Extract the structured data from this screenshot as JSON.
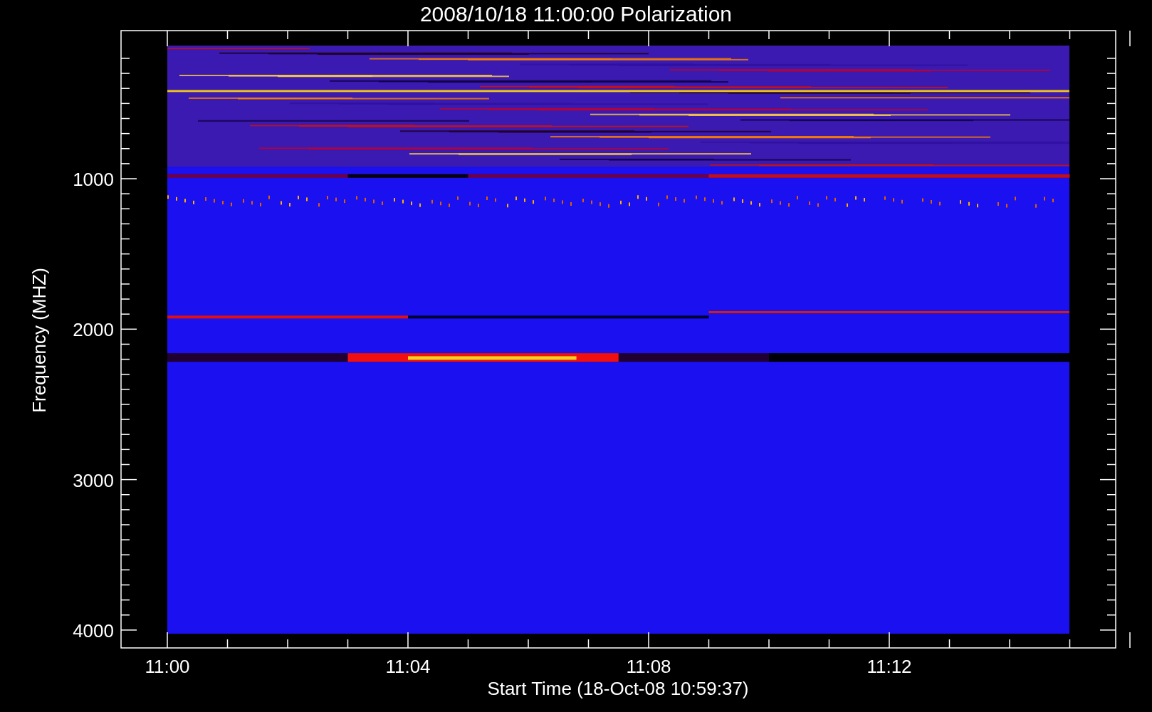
{
  "title": "2008/10/18 11:00:00 Polarization",
  "y_axis": {
    "label": "Frequency (MHZ)",
    "tick_labels": [
      "1000",
      "2000",
      "3000",
      "4000"
    ]
  },
  "x_axis": {
    "label": "Start Time (18-Oct-08 10:59:37)",
    "tick_labels": [
      "11:00",
      "11:04",
      "11:08",
      "11:12"
    ]
  }
}
